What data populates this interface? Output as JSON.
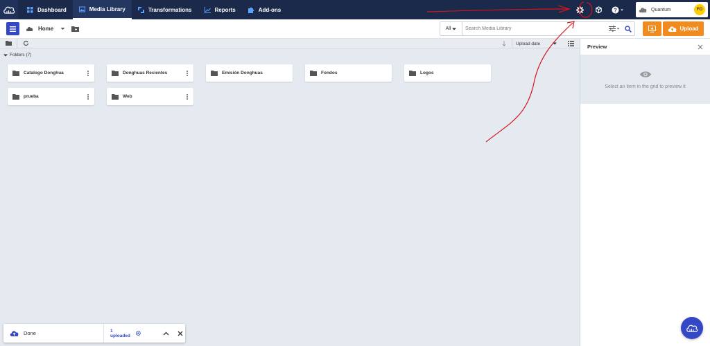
{
  "nav": {
    "items": [
      {
        "label": "Dashboard",
        "icon": "grid-icon"
      },
      {
        "label": "Media Library",
        "icon": "images-icon"
      },
      {
        "label": "Transformations",
        "icon": "transform-icon"
      },
      {
        "label": "Reports",
        "icon": "chart-icon"
      },
      {
        "label": "Add-ons",
        "icon": "puzzle-icon"
      }
    ],
    "account_name": "Quantum",
    "avatar_initials": "FO"
  },
  "toolbar": {
    "breadcrumb_home": "Home",
    "search_scope": "All",
    "search_placeholder": "Search Media Library",
    "upload_label": "Upload"
  },
  "subbar": {
    "sort_label": "Upload date"
  },
  "folders": {
    "header": "Folders (7)",
    "items": [
      {
        "name": "Catalogo Donghua"
      },
      {
        "name": "Donghuas Recientes"
      },
      {
        "name": "Emisión Donghuas"
      },
      {
        "name": "Fondos"
      },
      {
        "name": "Logos"
      },
      {
        "name": "prueba"
      },
      {
        "name": "Web"
      }
    ]
  },
  "preview": {
    "title": "Preview",
    "message": "Select an item in the grid to preview it"
  },
  "upload_status": {
    "state": "Done",
    "count": "1 uploaded"
  },
  "colors": {
    "nav_bg": "#1b2a4a",
    "accent_blue": "#3448c5",
    "upload_orange": "#f28b1e",
    "annotation_red": "#d4141c"
  }
}
